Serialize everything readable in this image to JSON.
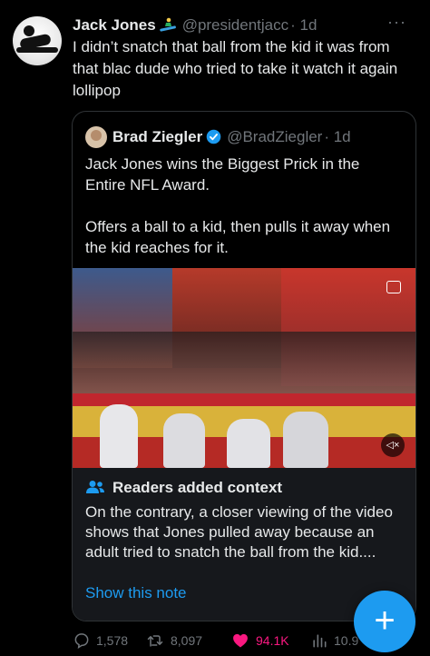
{
  "tweet": {
    "author_name": "Jack Jones",
    "author_handle": "@presidentjacc",
    "time": "· 1d",
    "more_label": "···",
    "text": "I didn’t snatch that ball from the kid it was from that blac dude who tried to take it watch it again lollipop"
  },
  "quote": {
    "author_name": "Brad Ziegler",
    "author_handle": "@BradZiegler",
    "time": "· 1d",
    "text_line1": "Jack Jones wins the Biggest Prick in the Entire NFL Award.",
    "text_line2": "Offers a ball to a kid, then pulls it away when the kid reaches for it.",
    "mute_label": "◁×"
  },
  "context": {
    "title": "Readers added context",
    "body": "On the contrary, a closer viewing of the video shows that Jones pulled away because an adult tried to snatch the ball from the kid....",
    "link": "Show this note"
  },
  "actions": {
    "replies": "1,578",
    "reposts": "8,097",
    "likes": "94.1K",
    "views": "10.9"
  },
  "fab_label": "+",
  "colors": {
    "background": "#000000",
    "accent": "#1d9bf0",
    "like": "#f91880",
    "muted": "#71767b",
    "card": "#16181c"
  }
}
